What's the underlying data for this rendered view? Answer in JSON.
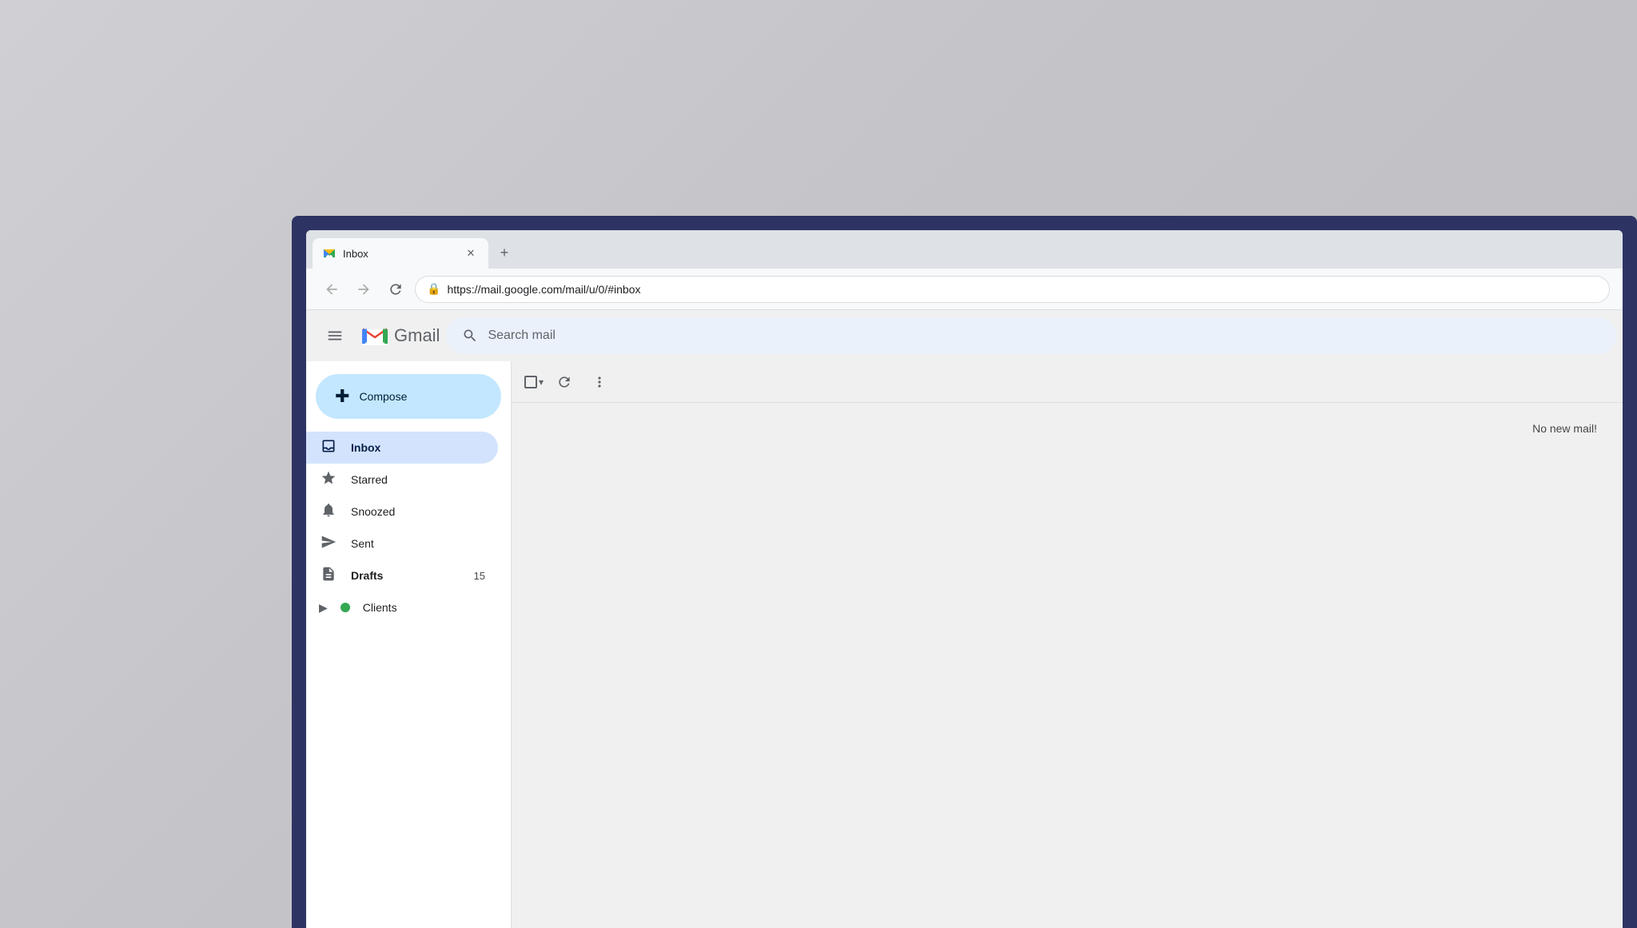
{
  "desktop": {
    "background": "#c5c5c9"
  },
  "browser": {
    "tab": {
      "title": "Inbox",
      "favicon": "M",
      "url": "https://mail.google.com/mail/u/0/#inbox"
    },
    "new_tab_label": "+",
    "nav": {
      "back_title": "Back",
      "forward_title": "Forward",
      "reload_title": "Reload"
    }
  },
  "gmail": {
    "app_name": "Gmail",
    "search_placeholder": "Search mail",
    "compose_label": "Compose",
    "sidebar": {
      "items": [
        {
          "id": "inbox",
          "label": "Inbox",
          "icon": "inbox",
          "active": true,
          "count": ""
        },
        {
          "id": "starred",
          "label": "Starred",
          "icon": "star",
          "active": false,
          "count": ""
        },
        {
          "id": "snoozed",
          "label": "Snoozed",
          "icon": "clock",
          "active": false,
          "count": ""
        },
        {
          "id": "sent",
          "label": "Sent",
          "icon": "sent",
          "active": false,
          "count": ""
        },
        {
          "id": "drafts",
          "label": "Drafts",
          "icon": "drafts",
          "active": false,
          "count": "15"
        },
        {
          "id": "clients",
          "label": "Clients",
          "icon": "dot",
          "active": false,
          "count": "",
          "has_chevron": true
        }
      ]
    },
    "toolbar": {
      "select_all_title": "Select all",
      "refresh_title": "Refresh",
      "more_title": "More options"
    },
    "main": {
      "empty_message": "No new mail!"
    }
  }
}
